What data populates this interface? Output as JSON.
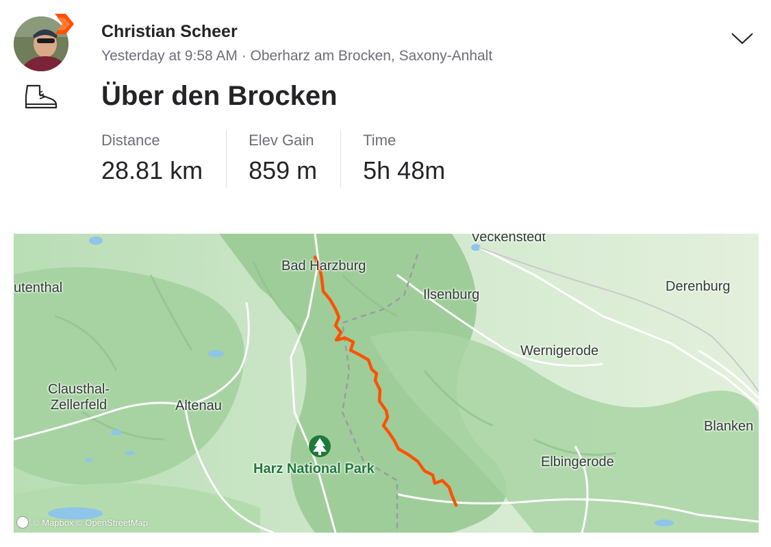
{
  "header": {
    "athlete_name": "Christian Scheer",
    "meta": "Yesterday at 9:58 AM · Oberharz am Brocken, Saxony-Anhalt",
    "activity_title": "Über den Brocken"
  },
  "stats": [
    {
      "label": "Distance",
      "value": "28.81 km"
    },
    {
      "label": "Elev Gain",
      "value": "859 m"
    },
    {
      "label": "Time",
      "value": "5h 48m"
    }
  ],
  "map": {
    "labels": {
      "veckenstedt": "Veckenstedt",
      "bad_harzburg": "Bad Harzburg",
      "utenthal": "utenthal",
      "ilsenburg": "Ilsenburg",
      "derenburg": "Derenburg",
      "wernigerode": "Wernigerode",
      "clausthal": "Clausthal-\nZellerfeld",
      "altenau": "Altenau",
      "harz_national_park": "Harz National Park",
      "blanken": "Blanken",
      "elbingerode": "Elbingerode"
    },
    "attribution": "© Mapbox © OpenStreetMap",
    "route_color": "#fc5200"
  },
  "colors": {
    "accent": "#fc5200",
    "badge": "#fc5200"
  },
  "icons": {
    "activity_type": "hiking-boot-icon",
    "menu": "chevron-down-icon",
    "park": "tree-icon"
  }
}
